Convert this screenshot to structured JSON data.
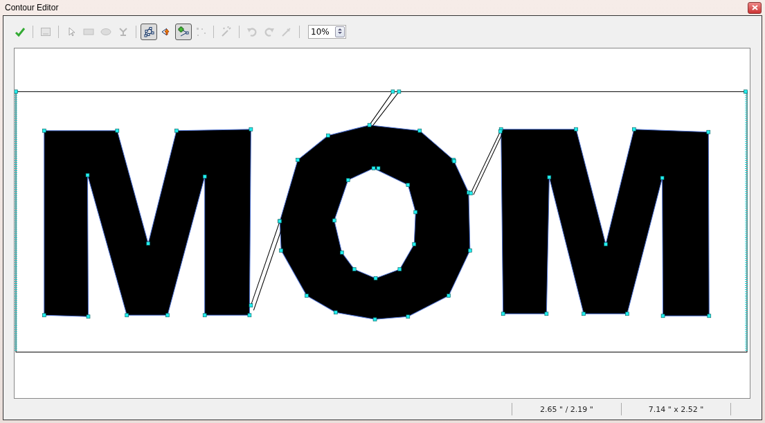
{
  "window": {
    "title": "Contour Editor"
  },
  "toolbar": {
    "groups": [
      {
        "tools": [
          {
            "disabled": false,
            "selected": false
          }
        ]
      },
      {
        "tools": [
          {
            "disabled": true,
            "selected": false
          }
        ]
      },
      {
        "tools": [
          {
            "disabled": true,
            "selected": false
          },
          {
            "disabled": true,
            "selected": false
          },
          {
            "disabled": true,
            "selected": false
          },
          {
            "disabled": true,
            "selected": false
          }
        ]
      },
      {
        "tools": [
          {
            "disabled": false,
            "selected": true
          },
          {
            "disabled": false,
            "selected": false
          },
          {
            "disabled": false,
            "selected": true
          },
          {
            "disabled": true,
            "selected": false
          }
        ]
      },
      {
        "tools": [
          {
            "disabled": true,
            "selected": false
          }
        ]
      },
      {
        "tools": [
          {
            "disabled": true,
            "selected": false
          },
          {
            "disabled": true,
            "selected": false
          },
          {
            "disabled": true,
            "selected": false
          }
        ]
      }
    ],
    "zoom": {
      "value": "10%"
    }
  },
  "status_bar": {
    "position": "2.65 \" / 2.19 \"",
    "size": "7.14 \" x 2.52 \""
  }
}
